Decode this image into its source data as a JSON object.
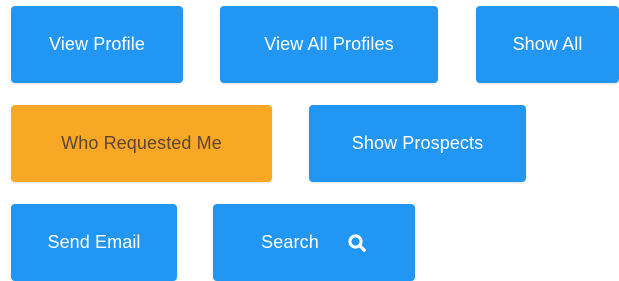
{
  "buttons": {
    "view_profile": "View Profile",
    "view_all_profiles": "View All Profiles",
    "show_all": "Show All",
    "who_requested_me": "Who Requested Me",
    "show_prospects": "Show Prospects",
    "send_email": "Send Email",
    "search": "Search"
  },
  "icons": {
    "search": "search-icon"
  },
  "colors": {
    "primary": "#2196f3",
    "highlight": "#f9a825",
    "highlight_text": "#5b4636",
    "text": "#ffffff"
  }
}
